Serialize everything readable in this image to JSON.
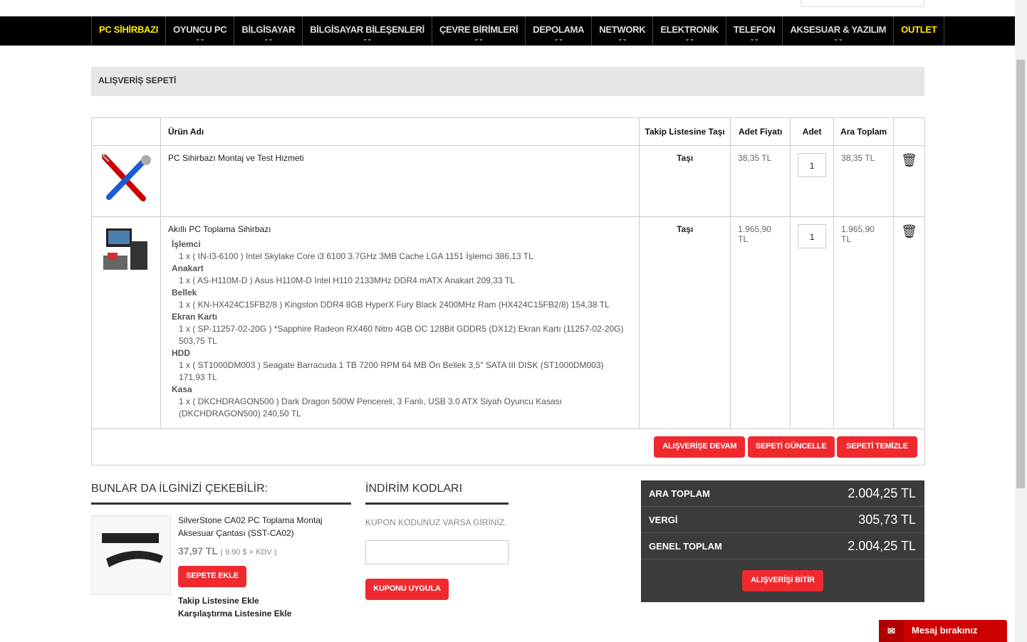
{
  "nav": [
    {
      "label": "PC SİHİRBAZI",
      "hl": true
    },
    {
      "label": "OYUNCU PC"
    },
    {
      "label": "BİLGİSAYAR"
    },
    {
      "label": "BİLGİSAYAR BİLEŞENLERİ"
    },
    {
      "label": "ÇEVRE BİRİMLERİ"
    },
    {
      "label": "DEPOLAMA"
    },
    {
      "label": "NETWORK"
    },
    {
      "label": "ELEKTRONİK"
    },
    {
      "label": "TELEFON"
    },
    {
      "label": "AKSESUAR & YAZILIM"
    },
    {
      "label": "OUTLET",
      "hl": true
    }
  ],
  "page_title": "ALIŞVERİŞ SEPETİ",
  "cart": {
    "headers": {
      "name": "Ürün Adı",
      "watch": "Takip Listesine Taşı",
      "unit_price": "Adet Fiyatı",
      "qty": "Adet",
      "subtotal": "Ara Toplam"
    },
    "rows": [
      {
        "name": "PC Sihirbazı Montaj ve Test Hizmeti",
        "move": "Taşı",
        "unit_price": "38,35 TL",
        "qty": "1",
        "subtotal": "38,35 TL"
      },
      {
        "name": "Akıllı PC Toplama Sihirbazı",
        "move": "Taşı",
        "unit_price": "1.965,90 TL",
        "qty": "1",
        "subtotal": "1.965,90 TL",
        "components": [
          {
            "cat": "İşlemci",
            "item": "1 x ( IN-I3-6100 ) Intel Skylake Core i3 6100 3.7GHz 3MB Cache LGA 1151 İşlemci 386,13 TL"
          },
          {
            "cat": "Anakart",
            "item": "1 x ( AS-H110M-D ) Asus H110M-D Intel H110 2133MHz DDR4 mATX Anakart 209,33 TL"
          },
          {
            "cat": "Bellek",
            "item": "1 x ( KN-HX424C15FB2/8 ) Kingston DDR4 8GB HyperX Fury Black 2400MHz Ram (HX424C15FB2/8) 154,38 TL"
          },
          {
            "cat": "Ekran Kartı",
            "item": "1 x ( SP-11257-02-20G ) *Sapphire Radeon RX460 Nitro 4GB OC 128Bit GDDR5 (DX12) Ekran Kartı (11257-02-20G) 503,75 TL"
          },
          {
            "cat": "HDD",
            "item": "1 x ( ST1000DM003 ) Seagate Barracuda 1 TB 7200 RPM 64 MB Ön Bellek 3,5\" SATA III DISK (ST1000DM003) 171,93 TL"
          },
          {
            "cat": "Kasa",
            "item": "1 x ( DKCHDRAGON500 ) Dark Dragon 500W Pencereli, 3 Fanlı, USB 3.0 ATX Siyah Oyuncu Kasası (DKCHDRAGON500) 240,50 TL"
          }
        ]
      }
    ],
    "buttons": {
      "continue": "ALIŞVERİŞE DEVAM",
      "update": "SEPETİ GÜNCELLE",
      "clear": "SEPETİ TEMİZLE"
    }
  },
  "suggest": {
    "title": "BUNLAR DA İLGİNİZİ ÇEKEBİLİR:",
    "product": "SilverStone CA02 PC Toplama Montaj Aksesuar Çantası (SST-CA02)",
    "price": "37,97 TL",
    "price_note": "( 9.90 $ + KDV )",
    "add": "SEPETE EKLE",
    "watch": "Takip Listesine Ekle",
    "compare": "Karşılaştırma Listesine Ekle"
  },
  "coupon": {
    "title": "İNDİRİM KODLARI",
    "label": "KUPON KODUNUZ VARSA GİRİNİZ.",
    "value": "",
    "apply": "KUPONU UYGULA"
  },
  "totals": {
    "subtotal_label": "ARA TOPLAM",
    "subtotal": "2.004,25 TL",
    "tax_label": "VERGİ",
    "tax": "305,73 TL",
    "total_label": "GENEL TOPLAM",
    "total": "2.004,25 TL",
    "checkout": "ALIŞVERİŞİ BİTİR"
  },
  "chat": {
    "label": "Mesaj bırakınız"
  }
}
